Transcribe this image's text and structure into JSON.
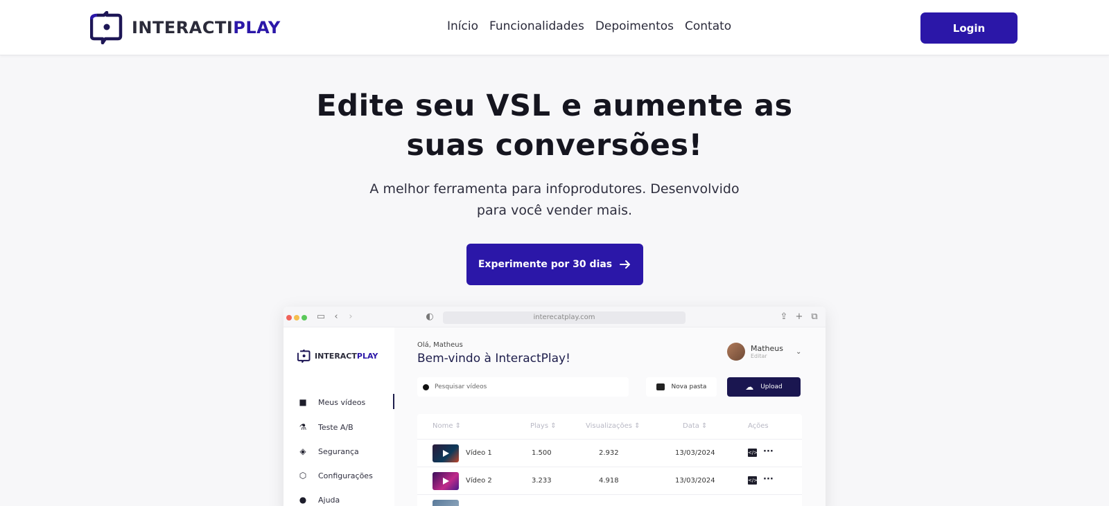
{
  "brand": {
    "name_part1": "INTERACTI",
    "name_part2": "PLAY",
    "accent_color": "#2b17a8"
  },
  "nav": {
    "links": [
      "Início",
      "Funcionalidades",
      "Depoimentos",
      "Contato"
    ],
    "login_label": "Login"
  },
  "hero": {
    "title_line1": "Edite seu VSL e aumente as",
    "title_line2": "suas conversões!",
    "subtitle_line1": "A melhor ferramenta para infoprodutores. Desenvolvido",
    "subtitle_line2": "para você vender mais.",
    "cta_label": "Experimente por 30 dias"
  },
  "mockup": {
    "url": "interecatplay.com",
    "sidebar": {
      "logo_part1": "INTERACT",
      "logo_part2": "PLAY",
      "items": [
        {
          "label": "Meus vídeos",
          "icon": "video-camera-icon"
        },
        {
          "label": "Teste A/B",
          "icon": "flask-icon"
        },
        {
          "label": "Segurança",
          "icon": "shield-icon"
        },
        {
          "label": "Configurações",
          "icon": "gear-icon"
        },
        {
          "label": "Ajuda",
          "icon": "help-icon"
        }
      ]
    },
    "greeting": "Olá, Matheus",
    "welcome": "Bem-vindo à InteractPlay!",
    "user": {
      "name": "Matheus",
      "action": "Editar"
    },
    "search_placeholder": "Pesquisar vídeos",
    "new_folder_label": "Nova pasta",
    "upload_label": "Upload",
    "table": {
      "headers": [
        "Nome ⇕",
        "Plays ⇕",
        "Visualizações ⇕",
        "Data ⇕",
        "Ações"
      ],
      "rows": [
        {
          "name": "Vídeo 1",
          "plays": "1.500",
          "views": "2.932",
          "date": "13/03/2024"
        },
        {
          "name": "Vídeo 2",
          "plays": "3.233",
          "views": "4.918",
          "date": "13/03/2024"
        }
      ]
    }
  }
}
